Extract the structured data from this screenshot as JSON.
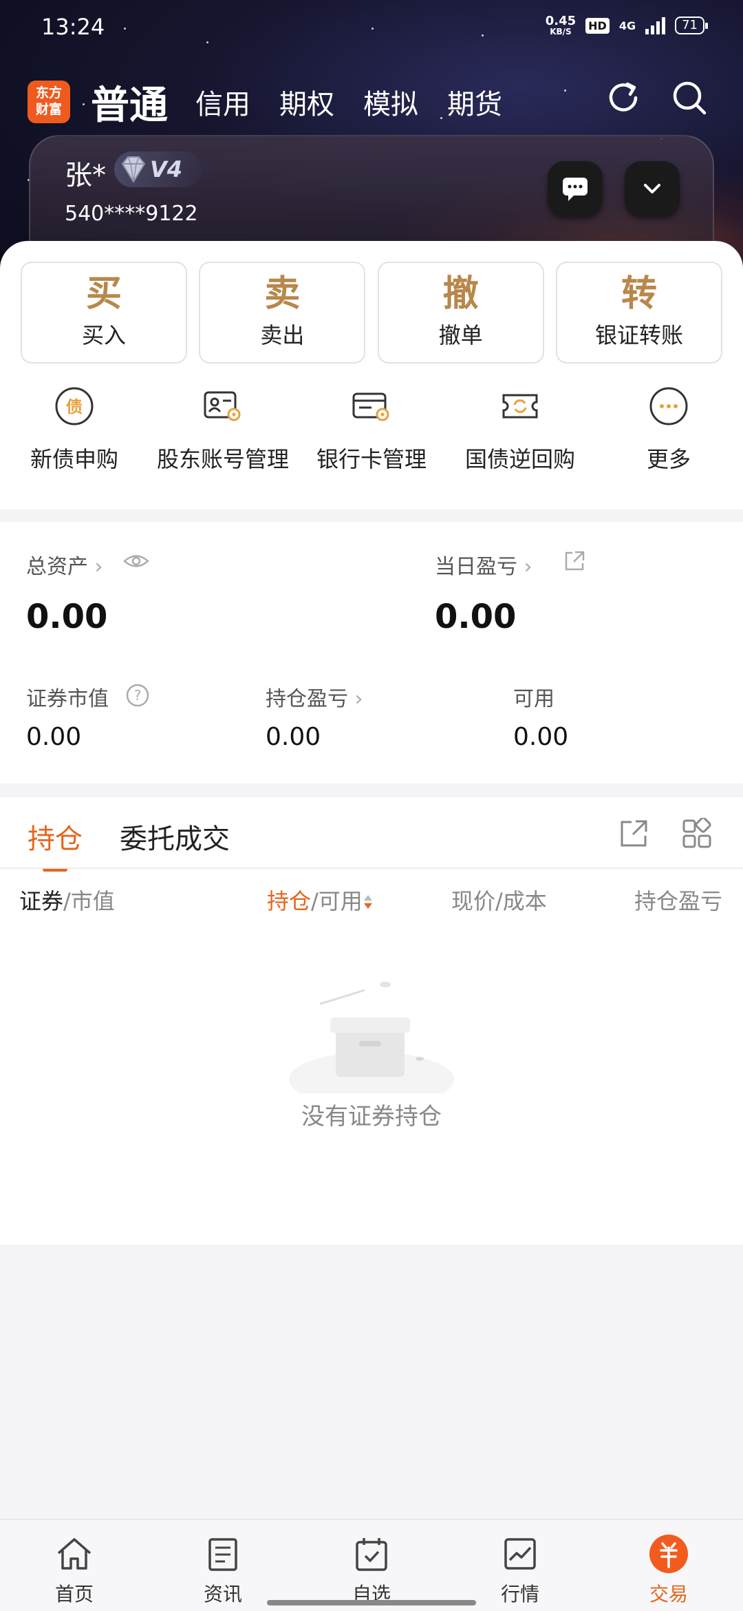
{
  "status_bar": {
    "time": "13:24",
    "net_speed": "0.45",
    "net_unit": "KB/S",
    "hd": "HD",
    "network": "4G",
    "battery": "71"
  },
  "header": {
    "logo_line1": "东方",
    "logo_line2": "财富",
    "tabs": [
      "普通",
      "信用",
      "期权",
      "模拟",
      "期货"
    ],
    "active_tab": "普通"
  },
  "account": {
    "name": "张*",
    "level": "V4",
    "number": "540****9122"
  },
  "actions": [
    {
      "char": "买",
      "label": "买入"
    },
    {
      "char": "卖",
      "label": "卖出"
    },
    {
      "char": "撤",
      "label": "撤单"
    },
    {
      "char": "转",
      "label": "银证转账"
    }
  ],
  "tools": [
    {
      "label": "新债申购",
      "icon": "bond-icon",
      "icon_char": "债"
    },
    {
      "label": "股东账号管理",
      "icon": "shareholder-account-icon"
    },
    {
      "label": "银行卡管理",
      "icon": "bank-card-icon"
    },
    {
      "label": "国债逆回购",
      "icon": "reverse-repo-icon"
    },
    {
      "label": "更多",
      "icon": "more-icon"
    }
  ],
  "assets": {
    "total_label": "总资产",
    "total_value": "0.00",
    "daily_pl_label": "当日盈亏",
    "daily_pl_value": "0.00",
    "market_value_label": "证券市值",
    "market_value": "0.00",
    "position_pl_label": "持仓盈亏",
    "position_pl": "0.00",
    "available_label": "可用",
    "available": "0.00"
  },
  "positions": {
    "tabs": [
      "持仓",
      "委托成交"
    ],
    "columns": {
      "c1a": "证券",
      "c1b": "/市值",
      "c2a": "持仓",
      "c2b": "/可用",
      "c3": "现价/成本",
      "c4": "持仓盈亏"
    },
    "empty_text": "没有证券持仓"
  },
  "bottom_nav": [
    {
      "label": "首页",
      "icon": "home-icon"
    },
    {
      "label": "资讯",
      "icon": "news-icon"
    },
    {
      "label": "自选",
      "icon": "watchlist-icon"
    },
    {
      "label": "行情",
      "icon": "market-icon"
    },
    {
      "label": "交易",
      "icon": "trade-icon",
      "active": true
    }
  ],
  "colors": {
    "accent": "#e4661e",
    "gold": "#b8874a",
    "logo": "#ef5a1f"
  }
}
